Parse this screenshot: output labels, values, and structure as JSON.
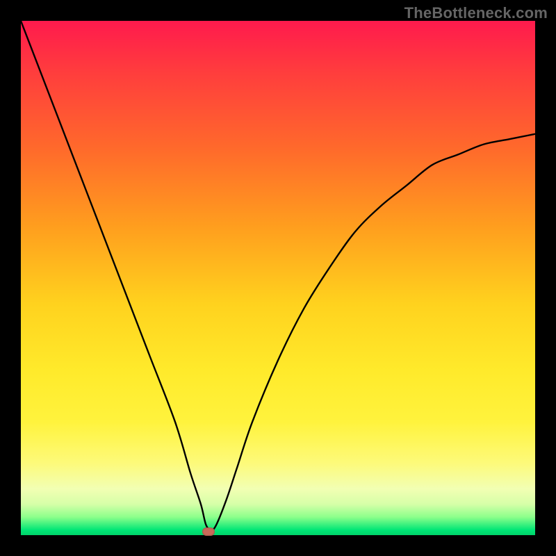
{
  "watermark": {
    "text": "TheBottleneck.com"
  },
  "chart_data": {
    "type": "line",
    "title": "",
    "xlabel": "",
    "ylabel": "",
    "xlim": [
      0,
      100
    ],
    "ylim": [
      0,
      100
    ],
    "grid": false,
    "legend": false,
    "series": [
      {
        "name": "bottleneck-curve",
        "x": [
          0,
          5,
          10,
          15,
          20,
          25,
          30,
          33,
          35,
          36,
          37,
          38,
          40,
          42,
          45,
          50,
          55,
          60,
          65,
          70,
          75,
          80,
          85,
          90,
          95,
          100
        ],
        "values": [
          100,
          87,
          74,
          61,
          48,
          35,
          22,
          12,
          6,
          2,
          1,
          2,
          7,
          13,
          22,
          34,
          44,
          52,
          59,
          64,
          68,
          72,
          74,
          76,
          77,
          78
        ]
      }
    ],
    "marker": {
      "x": 36.5,
      "y": 0.7,
      "color": "#c96a5a"
    },
    "background_gradient": {
      "orientation": "vertical",
      "stops": [
        {
          "pos": 0.0,
          "color": "#ff1a4d"
        },
        {
          "pos": 0.25,
          "color": "#ff6a2b"
        },
        {
          "pos": 0.55,
          "color": "#ffd21e"
        },
        {
          "pos": 0.78,
          "color": "#fff33d"
        },
        {
          "pos": 0.94,
          "color": "#d6ffa8"
        },
        {
          "pos": 1.0,
          "color": "#00d26a"
        }
      ]
    }
  }
}
